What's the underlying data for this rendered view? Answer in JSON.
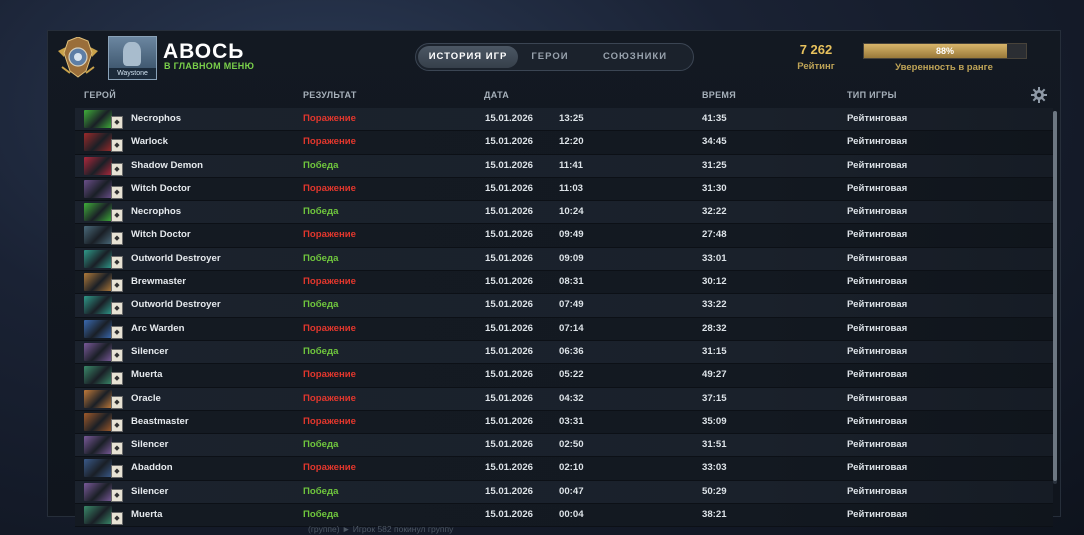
{
  "player": {
    "name": "АВОСЬ",
    "status": "В ГЛАВНОМ МЕНЮ",
    "avatar_caption": "Waystone"
  },
  "tabs": [
    {
      "label": "ИСТОРИЯ ИГР",
      "active": true
    },
    {
      "label": "ГЕРОИ",
      "active": false
    },
    {
      "label": "СОЮЗНИКИ",
      "active": false
    }
  ],
  "rating": {
    "value": "7 262",
    "label": "Рейтинг"
  },
  "confidence": {
    "percent_text": "88%",
    "percent": 88,
    "label": "Уверенность в ранге"
  },
  "columns": {
    "hero": "ГЕРОЙ",
    "result": "РЕЗУЛЬТАТ",
    "date": "ДАТА",
    "duration": "ВРЕМЯ",
    "game_type": "ТИП ИГРЫ"
  },
  "matches": [
    {
      "hero": "Necrophos",
      "result": "Поражение",
      "win": false,
      "date": "15.01.2026",
      "time": "13:25",
      "duration": "41:35",
      "type": "Рейтинговая",
      "color": "#3fae3a"
    },
    {
      "hero": "Warlock",
      "result": "Поражение",
      "win": false,
      "date": "15.01.2026",
      "time": "12:20",
      "duration": "34:45",
      "type": "Рейтинговая",
      "color": "#9b2a2a"
    },
    {
      "hero": "Shadow Demon",
      "result": "Победа",
      "win": true,
      "date": "15.01.2026",
      "time": "11:41",
      "duration": "31:25",
      "type": "Рейтинговая",
      "color": "#b0283c"
    },
    {
      "hero": "Witch Doctor",
      "result": "Поражение",
      "win": false,
      "date": "15.01.2026",
      "time": "11:03",
      "duration": "31:30",
      "type": "Рейтинговая",
      "color": "#6a4f8a"
    },
    {
      "hero": "Necrophos",
      "result": "Победа",
      "win": true,
      "date": "15.01.2026",
      "time": "10:24",
      "duration": "32:22",
      "type": "Рейтинговая",
      "color": "#3fae3a"
    },
    {
      "hero": "Witch Doctor",
      "result": "Поражение",
      "win": false,
      "date": "15.01.2026",
      "time": "09:49",
      "duration": "27:48",
      "type": "Рейтинговая",
      "color": "#4a6a7a"
    },
    {
      "hero": "Outworld Destroyer",
      "result": "Победа",
      "win": true,
      "date": "15.01.2026",
      "time": "09:09",
      "duration": "33:01",
      "type": "Рейтинговая",
      "color": "#2f9a8a"
    },
    {
      "hero": "Brewmaster",
      "result": "Поражение",
      "win": false,
      "date": "15.01.2026",
      "time": "08:31",
      "duration": "30:12",
      "type": "Рейтинговая",
      "color": "#b07a3a"
    },
    {
      "hero": "Outworld Destroyer",
      "result": "Победа",
      "win": true,
      "date": "15.01.2026",
      "time": "07:49",
      "duration": "33:22",
      "type": "Рейтинговая",
      "color": "#2f9a8a"
    },
    {
      "hero": "Arc Warden",
      "result": "Поражение",
      "win": false,
      "date": "15.01.2026",
      "time": "07:14",
      "duration": "28:32",
      "type": "Рейтинговая",
      "color": "#3a6ab0"
    },
    {
      "hero": "Silencer",
      "result": "Победа",
      "win": true,
      "date": "15.01.2026",
      "time": "06:36",
      "duration": "31:15",
      "type": "Рейтинговая",
      "color": "#7a5a9a"
    },
    {
      "hero": "Muerta",
      "result": "Поражение",
      "win": false,
      "date": "15.01.2026",
      "time": "05:22",
      "duration": "49:27",
      "type": "Рейтинговая",
      "color": "#3a8a6a"
    },
    {
      "hero": "Oracle",
      "result": "Поражение",
      "win": false,
      "date": "15.01.2026",
      "time": "04:32",
      "duration": "37:15",
      "type": "Рейтинговая",
      "color": "#c07a3a"
    },
    {
      "hero": "Beastmaster",
      "result": "Поражение",
      "win": false,
      "date": "15.01.2026",
      "time": "03:31",
      "duration": "35:09",
      "type": "Рейтинговая",
      "color": "#a05a2a"
    },
    {
      "hero": "Silencer",
      "result": "Победа",
      "win": true,
      "date": "15.01.2026",
      "time": "02:50",
      "duration": "31:51",
      "type": "Рейтинговая",
      "color": "#7a5a9a"
    },
    {
      "hero": "Abaddon",
      "result": "Поражение",
      "win": false,
      "date": "15.01.2026",
      "time": "02:10",
      "duration": "33:03",
      "type": "Рейтинговая",
      "color": "#3a5a8a"
    },
    {
      "hero": "Silencer",
      "result": "Победа",
      "win": true,
      "date": "15.01.2026",
      "time": "00:47",
      "duration": "50:29",
      "type": "Рейтинговая",
      "color": "#7a5a9a"
    },
    {
      "hero": "Muerta",
      "result": "Победа",
      "win": true,
      "date": "15.01.2026",
      "time": "00:04",
      "duration": "38:21",
      "type": "Рейтинговая",
      "color": "#3a8a6a"
    }
  ],
  "footer": "(группе) ► Игрок 582 покинул группу"
}
